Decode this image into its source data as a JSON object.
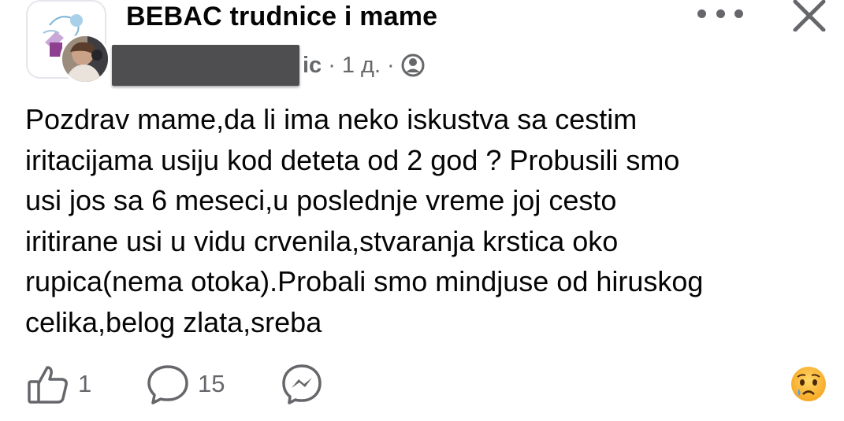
{
  "post": {
    "group_name": "BEBAC trudnice i mame",
    "author_tail": "ic",
    "separator": "·",
    "time": "1 д.",
    "text": "Pozdrav mame,da li ima neko iskustva sa cestim\niritacijama usiju kod deteta od 2 god ? Probusili smo\nusi jos sa 6 meseci,u poslednje vreme joj cesto\niritirane usi u vidu crvenila,stvaranja krstica oko\nrupica(nema otoka).Probali smo mindjuse od hiruskog\ncelika,belog zlata,sreba"
  },
  "icons": {
    "more": "more-dots-icon",
    "close": "close-icon",
    "audience": "globe-icon",
    "like": "thumbs-up-icon",
    "comment": "comment-bubble-icon",
    "share": "messenger-icon",
    "reaction": "crying-face-emoji"
  },
  "actions": {
    "like_count": "1",
    "comment_count": "15"
  },
  "colors": {
    "text": "#050505",
    "secondary": "#65676b",
    "redaction": "#4e4e50"
  }
}
